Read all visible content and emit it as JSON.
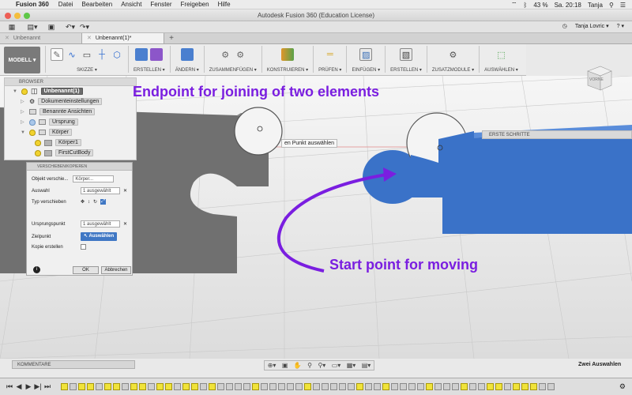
{
  "menubar": {
    "apple": "",
    "app_name": "Fusion 360",
    "items": [
      "Datei",
      "Bearbeiten",
      "Ansicht",
      "Fenster",
      "Freigeben",
      "Hilfe"
    ],
    "battery": "43 %",
    "clock": "Sa. 20:18",
    "user": "Tanja"
  },
  "window": {
    "title": "Autodesk Fusion 360 (Education License)"
  },
  "qat": {
    "user": "Tanja Lovric ▾",
    "help": "? ▾"
  },
  "tabs": [
    {
      "label": "Unbenannt"
    },
    {
      "label": "Unbenannt(1)*"
    }
  ],
  "ribbon": {
    "model_label": "MODELL ▾",
    "groups": [
      {
        "label": "SKIZZE ▾"
      },
      {
        "label": "ERSTELLEN ▾"
      },
      {
        "label": "ÄNDERN ▾"
      },
      {
        "label": "ZUSAMMENFÜGEN ▾"
      },
      {
        "label": "KONSTRUIEREN ▾"
      },
      {
        "label": "PRÜFEN ▾"
      },
      {
        "label": "EINFÜGEN ▾"
      },
      {
        "label": "ERSTELLEN ▾"
      },
      {
        "label": "ZUSATZMODULE ▾"
      },
      {
        "label": "AUSWÄHLEN ▾"
      }
    ]
  },
  "browser": {
    "header": "BROWSER",
    "root": "Unbenannt(1)",
    "items": [
      "Dokumenteinstellungen",
      "Benannte Ansichten",
      "Ursprung",
      "Körper",
      "Körper1",
      "FirstCutBody"
    ]
  },
  "dialog": {
    "header": "VERSCHIEBEN/KOPIEREN",
    "objekt_label": "Objekt verschie...",
    "objekt_value": "Körper...",
    "auswahl_label": "Auswahl",
    "auswahl_value": "1 ausgewählt",
    "typ_label": "Typ verschieben",
    "ursprung_label": "Ursprungspunkt",
    "ursprung_value": "1 ausgewählt",
    "ziel_label": "Zielpunkt",
    "ziel_button": "Auswählen",
    "kopie_label": "Kopie erstellen",
    "ok": "OK",
    "cancel": "Abbrechen"
  },
  "canvas": {
    "tooltip": "en Punkt auswählen",
    "erste_schritte": "ERSTE SCHRITTE",
    "annotation_top": "Endpoint for joining of two elements",
    "annotation_bottom": "Start point for moving",
    "viewcube_label": "VORNE",
    "annotation_color": "#7a1ee0",
    "body_color": "#3a72c8"
  },
  "bottom": {
    "kommentare": "KOMMENTARE",
    "selection_status": "Zwei Auswahlen"
  }
}
